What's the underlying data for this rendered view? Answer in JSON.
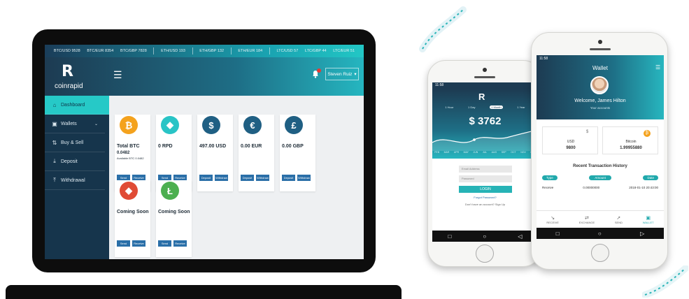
{
  "laptop": {
    "ticker": [
      "BTC/USD 9528",
      "BTC/EUR 8354",
      "BTC/GBP 7828",
      "ETH/USD 193",
      "ETH/GBP 132",
      "ETH/EUR 184",
      "LTC/USD 57",
      "LTC/GBP 44",
      "LTC/EUR 51"
    ],
    "logo_text": "coinrapid",
    "user_name": "Steven Ruiz",
    "sidebar": [
      {
        "label": "Dashboard",
        "icon": "home-icon"
      },
      {
        "label": "Wallets",
        "icon": "wallet-icon"
      },
      {
        "label": "Buy & Sell",
        "icon": "cart-icon"
      },
      {
        "label": "Deposit",
        "icon": "deposit-icon"
      },
      {
        "label": "Withdrawal",
        "icon": "withdraw-icon"
      }
    ],
    "cards": [
      {
        "symbol": "₿",
        "color": "#f4a21d",
        "title": "Total BTC",
        "sub": "0.0482",
        "sub2": "Available BTC 0.0482",
        "b1": "Send",
        "b2": "Receive"
      },
      {
        "symbol": "◆",
        "color": "#29c4c6",
        "title": "0 RPD",
        "sub": "",
        "sub2": "",
        "b1": "Send",
        "b2": "Receive"
      },
      {
        "symbol": "$",
        "color": "#1f5f83",
        "title": "497.00 USD",
        "sub": "",
        "sub2": "",
        "b1": "Deposit",
        "b2": "Withdraw"
      },
      {
        "symbol": "€",
        "color": "#1f5f83",
        "title": "0.00 EUR",
        "sub": "",
        "sub2": "",
        "b1": "Deposit",
        "b2": "Withdraw"
      },
      {
        "symbol": "£",
        "color": "#1f5f83",
        "title": "0.00 GBP",
        "sub": "",
        "sub2": "",
        "b1": "Deposit",
        "b2": "Withdraw"
      },
      {
        "symbol": "◆",
        "color": "#e04b35",
        "title": "Coming Soon",
        "sub": "",
        "sub2": "",
        "b1": "Send",
        "b2": "Receive"
      },
      {
        "symbol": "Ł",
        "color": "#4caf50",
        "title": "Coming Soon",
        "sub": "",
        "sub2": "",
        "b1": "Send",
        "b2": "Receive"
      }
    ]
  },
  "phone_left": {
    "status_time": "11:58",
    "price": "$ 3762",
    "tabs": [
      "1 Hour",
      "1 Day",
      "1 Month",
      "1 Year"
    ],
    "x_ticks": [
      "FEB",
      "MAR",
      "APR",
      "MAY",
      "JUN",
      "JUL",
      "AUG",
      "SEP",
      "OCT",
      "NOV",
      "DEC"
    ],
    "email_placeholder": "Email Address",
    "password_placeholder": "Password",
    "login_label": "LOGIN",
    "forgot_label": "Forgot Password?",
    "signup_text": "Don't have an account? Sign Up"
  },
  "phone_right": {
    "status_time": "11:58",
    "title": "Wallet",
    "welcome": "Welcome, James Hilton",
    "subtitle": "Your accounts",
    "acct_btc_label": "Bitcoin",
    "acct_btc_value": "1.99955880",
    "acct_usd_label": "USD",
    "acct_usd_value": "9800",
    "history_title": "Recent Transaction History",
    "col_date": "Date",
    "col_amount": "Amount",
    "col_type": "Type",
    "row_date": "2018-01-10 20:43:00",
    "row_amount": "0.00000000",
    "row_type": "Receive",
    "tabs": [
      "WALLET",
      "SEND",
      "EXCHANGE",
      "RECEIVE"
    ]
  }
}
